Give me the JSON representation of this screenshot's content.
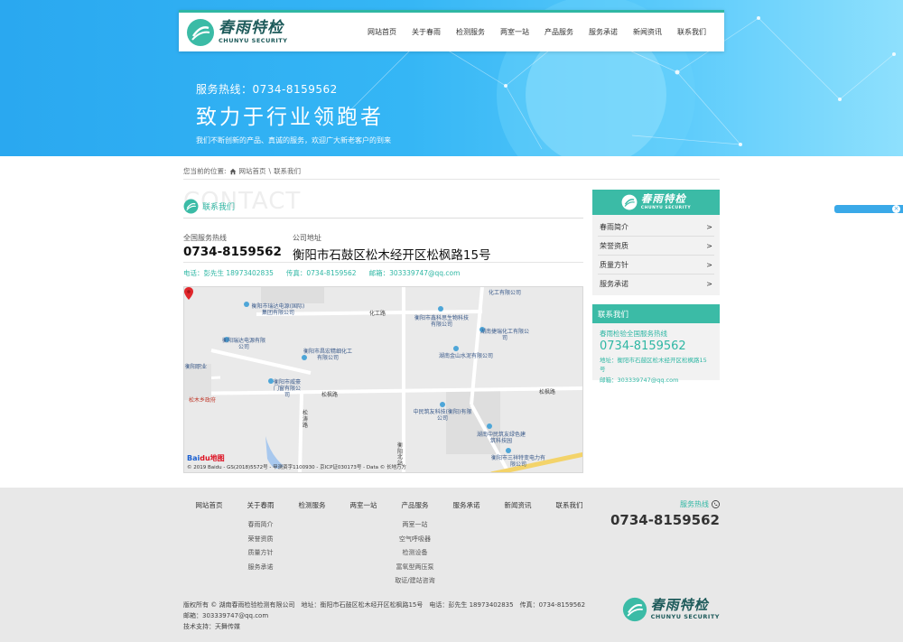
{
  "brand": {
    "name_cn": "春雨特检",
    "name_en": "CHUNYU SECURITY"
  },
  "nav": [
    "网站首页",
    "关于春雨",
    "检测服务",
    "两室一站",
    "产品服务",
    "服务承诺",
    "新闻资讯",
    "联系我们"
  ],
  "banner": {
    "hotline": "服务热线：0734-8159562",
    "motto": "致力于行业领跑者",
    "sub": "我们不断创新的产品、真诚的服务，欢迎广大新老客户的到来"
  },
  "breadcrumb": {
    "prefix": "您当前的位置:",
    "home": "网站首页",
    "sep": "\\",
    "current": "联系我们"
  },
  "section": {
    "watermark": "CONTACT",
    "title": "联系我们"
  },
  "info": {
    "phone_label": "全国服务热线",
    "phone": "0734-8159562",
    "address_label": "公司地址",
    "address": "衡阳市石鼓区松木经开区松枫路15号"
  },
  "contact_row": {
    "tel": "电话：彭先生 18973402835",
    "fax": "传真：0734-8159562",
    "email": "邮箱：303339747@qq.com"
  },
  "map": {
    "labels": [
      "衡阳市瑞达电源(国际)集团有限公司",
      "衡阳瑞达电源有限公司",
      "衡阳市鑫科思生物科技有限公司",
      "衡阳市昌宏精细化工有限公司",
      "湖南捷瑞化工有限公司",
      "湖南金山水泥有限公司",
      "衡阳市威豪门窗有限公司",
      "中民筑友科技(衡阳)有限公司",
      "湖南中民筑友绿色建筑科技园",
      "衡阳市三祥特变电力有限公司",
      "化工有限公司",
      "松木乡政府",
      "衡阳职业"
    ],
    "roads": [
      "化工路",
      "松枫路",
      "松枫路",
      "松涛路",
      "衡阳北站"
    ],
    "logo_a": "Bai",
    "logo_b": "du地图",
    "copyright": "© 2019 Baidu - GS(2018)5572号 - 甲测资字1100930 - 京ICP证030173号 - Data © 长地万方"
  },
  "sidebar": {
    "menu": [
      "春雨简介",
      "荣誉资质",
      "质量方针",
      "服务承诺"
    ],
    "arrow": ">",
    "contact_head": "联系我们",
    "contact_label": "春雨检验全国服务热线",
    "contact_phone": "0734-8159562",
    "contact_addr": "地址：衡阳市石鼓区松木经开区松枫路15号",
    "contact_email": "邮箱：303339747@qq.com"
  },
  "footer": {
    "cols": [
      {
        "head": "网站首页",
        "subs": []
      },
      {
        "head": "关于春雨",
        "subs": [
          "春雨简介",
          "荣誉资质",
          "质量方针",
          "服务承诺"
        ]
      },
      {
        "head": "检测服务",
        "subs": []
      },
      {
        "head": "两室一站",
        "subs": []
      },
      {
        "head": "产品服务",
        "subs": [
          "两室一站",
          "空气呼吸器",
          "检测设备",
          "富氧型两压泵",
          "取证/建站咨询"
        ]
      },
      {
        "head": "服务承诺",
        "subs": []
      },
      {
        "head": "新闻资讯",
        "subs": []
      },
      {
        "head": "联系我们",
        "subs": []
      }
    ],
    "hot_label": "服务热线",
    "hot_phone": "0734-8159562",
    "copy1": "版权所有 © 湖南春雨检验检测有限公司　地址：衡阳市石鼓区松木经开区松枫路15号　电话：彭先生 18973402835　传真：0734-8159562",
    "copy2": "邮箱：303339747@qq.com",
    "copy3": "技术支持：天舞传媒"
  },
  "colors": {
    "accent": "#2fb7a4",
    "banner": "#35b6f5"
  }
}
